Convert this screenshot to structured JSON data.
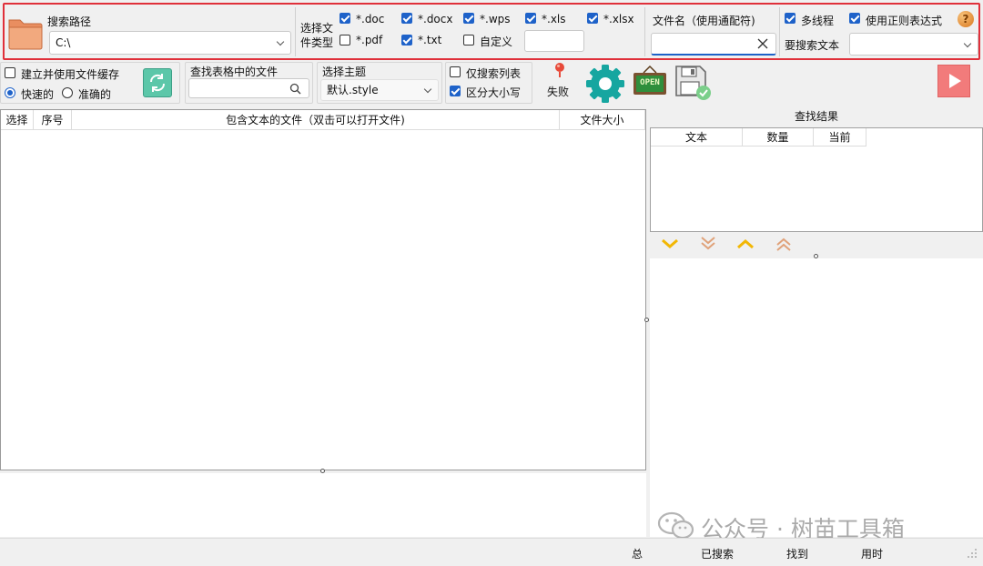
{
  "toolbar": {
    "search_path_label": "搜索路径",
    "search_path_value": "C:\\",
    "file_type_label_1": "选择文",
    "file_type_label_2": "件类型",
    "types": {
      "doc": "*.doc",
      "docx": "*.docx",
      "wps": "*.wps",
      "xls": "*.xls",
      "xlsx": "*.xlsx",
      "pdf": "*.pdf",
      "txt": "*.txt",
      "custom": "自定义"
    },
    "filename_label": "文件名（使用通配符)",
    "multithread_label": "多线程",
    "regex_label": "使用正则表达式",
    "search_text_label": "要搜索文本"
  },
  "toolbar2": {
    "cache_label": "建立并使用文件缓存",
    "fast_label": "快速的",
    "accurate_label": "准确的",
    "find_in_table_label": "查找表格中的文件",
    "theme_label": "选择主题",
    "theme_value": "默认.style",
    "only_list_label": "仅搜索列表",
    "case_label": "区分大小写",
    "fail_label": "失败",
    "open_label": "OPEN"
  },
  "list": {
    "columns": [
      "选择",
      "序号",
      "包含文本的文件（双击可以打开文件)",
      "文件大小"
    ]
  },
  "results": {
    "title": "查找结果",
    "columns": [
      "文本",
      "数量",
      "当前"
    ]
  },
  "status": {
    "total": "总",
    "searched": "已搜索",
    "found": "找到",
    "elapsed": "用时"
  },
  "watermark": "公众号 · 树苗工具箱",
  "colors": {
    "highlight": "#e0303a",
    "accent": "#1e62c9",
    "gear": "#16a6a0",
    "play": "#f27b7b",
    "folder": "#f2a97e",
    "arrow_yellow": "#f2b705"
  }
}
